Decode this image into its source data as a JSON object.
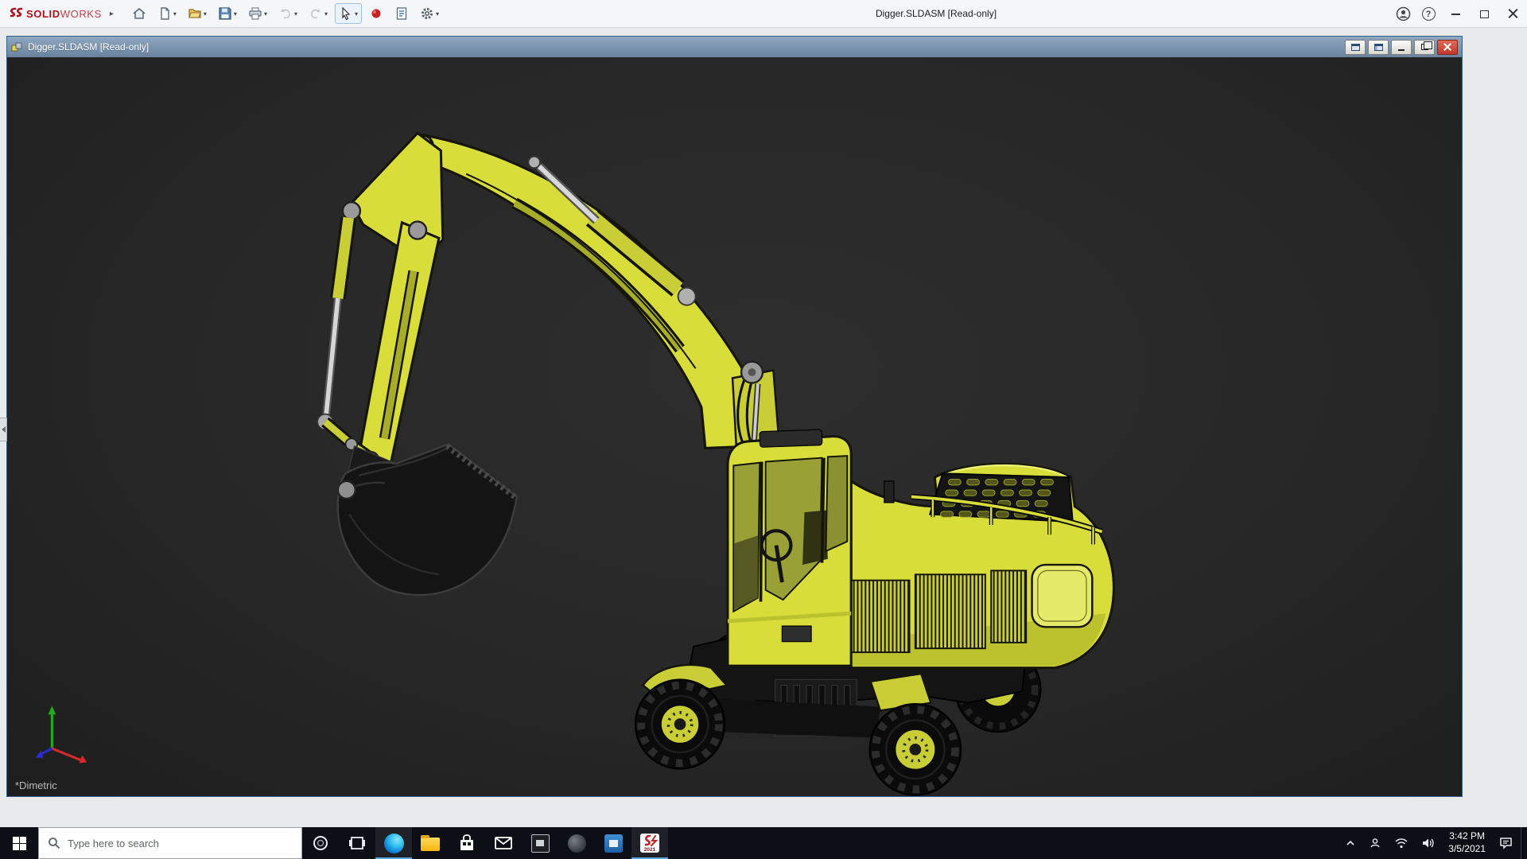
{
  "ui": {
    "caret": "▾",
    "expander": "▸",
    "help_glyph": "?"
  },
  "app": {
    "titlebar": {
      "logo": {
        "solid": "SOLID",
        "works": "WORKS"
      },
      "title": "Digger.SLDASM [Read-only]",
      "tools": [
        "home",
        "new-document",
        "open",
        "save",
        "print",
        "undo",
        "redo",
        "select",
        "xpress-red",
        "design-binder",
        "options"
      ],
      "window_controls": [
        "account",
        "help",
        "minimize",
        "maximize",
        "close"
      ]
    },
    "document_window": {
      "title": "Digger.SLDASM [Read-only]",
      "controls": [
        "tile-pane",
        "tile-pane-alt",
        "minimize",
        "restore",
        "close"
      ]
    },
    "viewport": {
      "view_label": "*Dimetric",
      "model": "wheeled-excavator-assembly",
      "triad_axes": [
        "X",
        "Y",
        "Z"
      ]
    },
    "colors": {
      "model_yellow": "#d8dd3a",
      "model_outline": "#15150a",
      "viewport_background": "#272727",
      "doc_titlebar_blue": "#7b92ad",
      "taskbar_background": "#0c0f15",
      "logo_red": "#b50f1d",
      "triad_x_red": "#d42a2a",
      "triad_y_green": "#1faa1f",
      "triad_z_blue": "#2a2ad4"
    }
  },
  "taskbar": {
    "search_placeholder": "Type here to search",
    "apps": [
      "start",
      "search",
      "cortana",
      "task-view",
      "edge",
      "file-explorer",
      "microsoft-store",
      "mail",
      "photos-dark-tile",
      "gray-circle-app",
      "blue-tile-app",
      "solidworks-2021"
    ],
    "solidworks_badge": "2021",
    "clock": {
      "time": "3:42 PM",
      "date": "3/5/2021"
    },
    "tray_icons": [
      "hidden-icons-chevron",
      "contact",
      "network-wifi",
      "volume",
      "action-center"
    ]
  }
}
